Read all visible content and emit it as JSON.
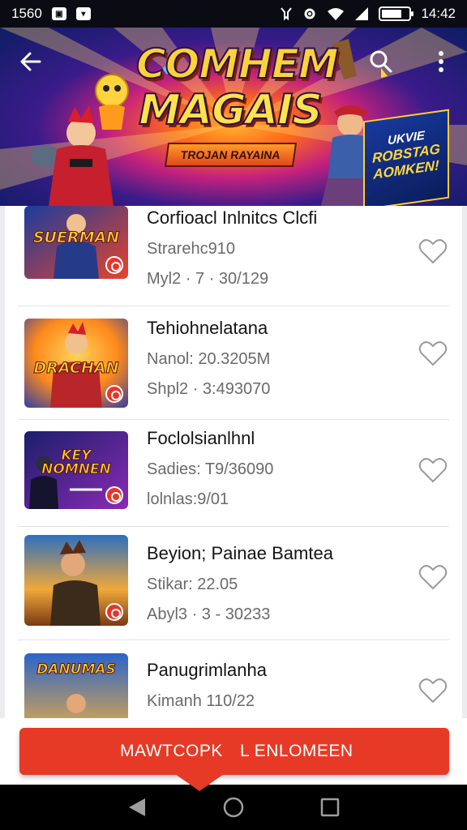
{
  "status_bar": {
    "left_text": "1560",
    "icon_1": "notification-icon",
    "icon_2": "notification-icon",
    "time": "14:42",
    "battery_level": 0.75
  },
  "header": {
    "title_line_1": "COMHEM",
    "title_line_2": "MAGAIS",
    "ribbon_text": "TROJAN RAYAINA",
    "promo_line_1": "UKVIE",
    "promo_line_2": "ROBSTAG",
    "promo_line_3": "AOMKEN!",
    "back_icon": "arrow-left-icon",
    "search_icon": "search-icon",
    "more_icon": "more-vert-icon"
  },
  "list": {
    "items": [
      {
        "title": "Corfioacl Inlnitcs Clcfi",
        "subtitle": "Strarehc910",
        "meta": "Myl2 · 7 · 30/129",
        "thumb_label": "SUERMAN",
        "thumb_colors": [
          "#1a3c9e",
          "#e8432a"
        ]
      },
      {
        "title": "Tehiohnelatana",
        "subtitle": "Nanol: 20.3205M",
        "meta": "Shpl2 · 3:493070",
        "thumb_label": "DRACHAN",
        "thumb_colors": [
          "#ff8a1c",
          "#2a3aa8"
        ]
      },
      {
        "title": "Foclolsianlhnl",
        "subtitle": "Sadies: T9/36090",
        "meta": "lolnlas:9/01",
        "thumb_label": "KEY NOMNEN",
        "thumb_colors": [
          "#1b1f6b",
          "#8a2ab5"
        ]
      },
      {
        "title": "Beyion; Painae Bamtea",
        "subtitle": "Stikar: 22.05",
        "meta": "Abyl3 · 3 - 30233",
        "thumb_label": "",
        "thumb_colors": [
          "#f0a83a",
          "#2d6fbf"
        ]
      },
      {
        "title": "Panugrimlanha",
        "subtitle": "Kimanh 110/22",
        "meta": "",
        "thumb_label": "DANUMAS",
        "thumb_colors": [
          "#2a64c9",
          "#f7b23a"
        ]
      }
    ],
    "favorite_icon": "heart-outline-icon"
  },
  "cta": {
    "left_label": "MAWTCOPK",
    "right_label": "L ENLOMEEN"
  },
  "nav": {
    "back_icon": "triangle-back-icon",
    "home_icon": "circle-home-icon",
    "recents_icon": "square-recents-icon"
  },
  "colors": {
    "accent": "#e63a26",
    "status_bar": "#0b0b14",
    "nav_bar": "#000000"
  }
}
